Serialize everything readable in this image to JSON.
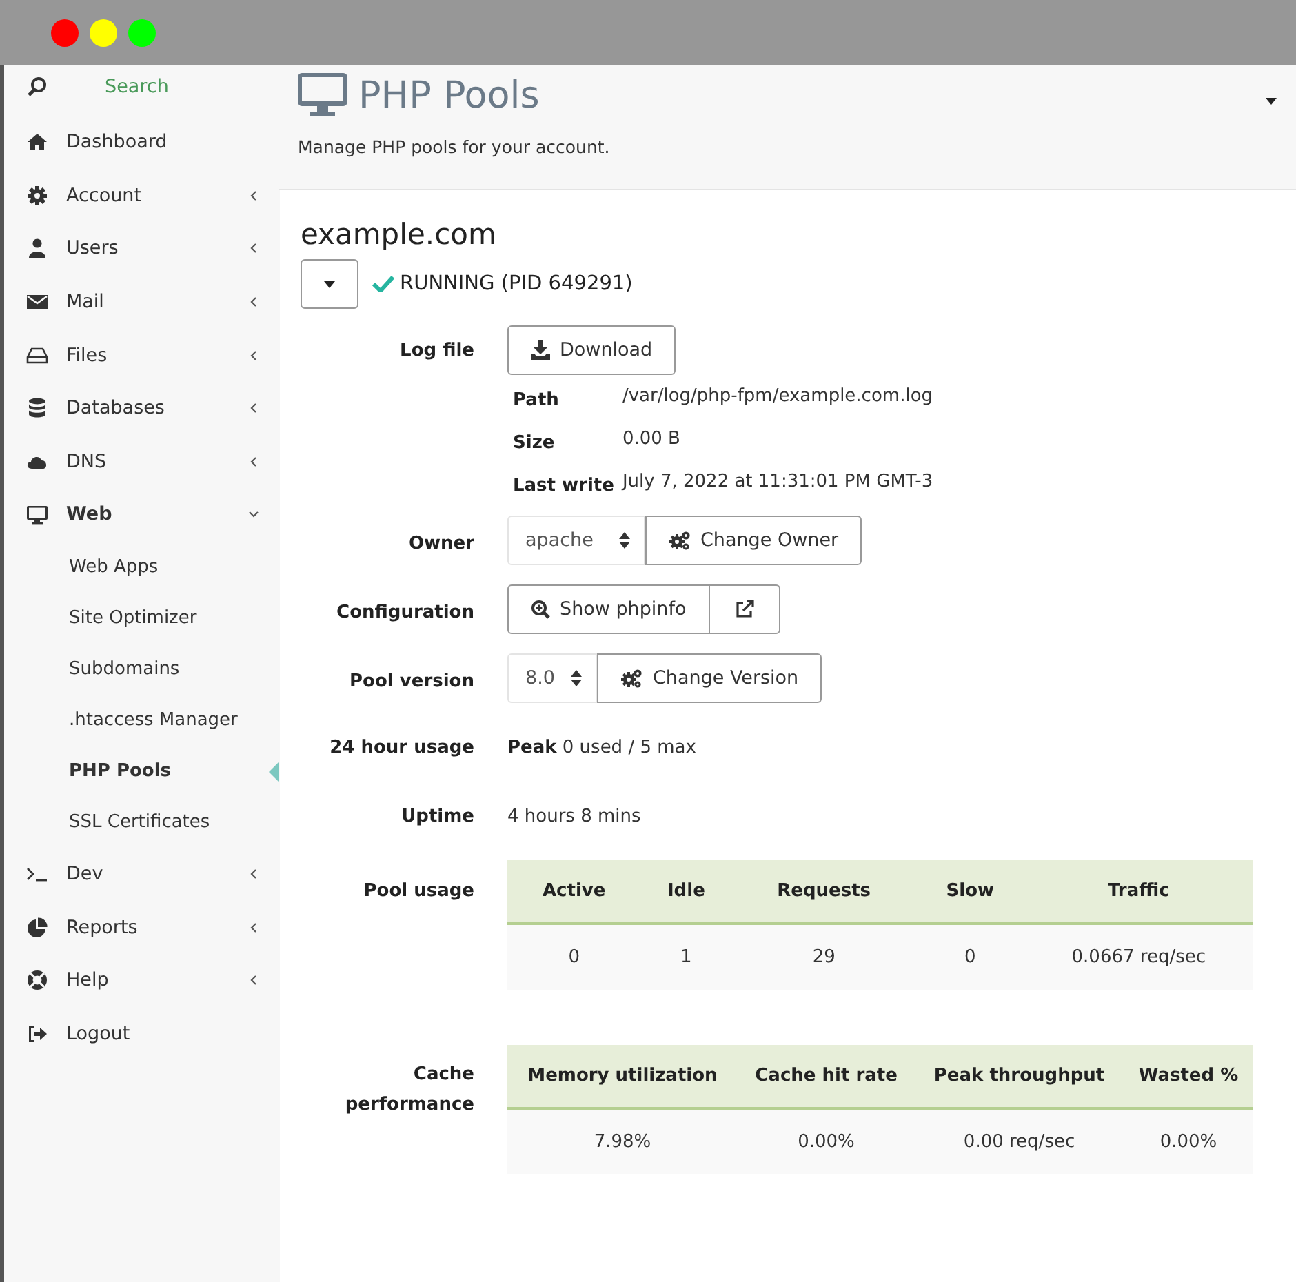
{
  "sidebar": {
    "search": {
      "placeholder": "Search"
    },
    "items": [
      {
        "label": "Dashboard",
        "expandable": false,
        "expanded": false
      },
      {
        "label": "Account",
        "expandable": true,
        "expanded": false
      },
      {
        "label": "Users",
        "expandable": true,
        "expanded": false
      },
      {
        "label": "Mail",
        "expandable": true,
        "expanded": false
      },
      {
        "label": "Files",
        "expandable": true,
        "expanded": false
      },
      {
        "label": "Databases",
        "expandable": true,
        "expanded": false
      },
      {
        "label": "DNS",
        "expandable": true,
        "expanded": false
      },
      {
        "label": "Web",
        "expandable": true,
        "expanded": true,
        "children": [
          {
            "label": "Web Apps",
            "selected": false
          },
          {
            "label": "Site Optimizer",
            "selected": false
          },
          {
            "label": "Subdomains",
            "selected": false
          },
          {
            "label": ".htaccess Manager",
            "selected": false
          },
          {
            "label": "PHP Pools",
            "selected": true
          },
          {
            "label": "SSL Certificates",
            "selected": false
          }
        ]
      },
      {
        "label": "Dev",
        "expandable": true,
        "expanded": false
      },
      {
        "label": "Reports",
        "expandable": true,
        "expanded": false
      },
      {
        "label": "Help",
        "expandable": true,
        "expanded": false
      },
      {
        "label": "Logout",
        "expandable": false,
        "expanded": false
      }
    ]
  },
  "header": {
    "title": "PHP Pools",
    "subtitle": "Manage PHP pools for your account."
  },
  "pool": {
    "name": "example.com",
    "status": "RUNNING (PID 649291)",
    "running": true,
    "log_file": {
      "label": "Log file",
      "button": "Download",
      "details": [
        {
          "label": "Path",
          "value": "/var/log/php-fpm/example.com.log"
        },
        {
          "label": "Size",
          "value": "0.00 B"
        },
        {
          "label": "Last write",
          "value": "July 7, 2022 at 11:31:01 PM GMT-3"
        }
      ]
    },
    "owner": {
      "label": "Owner",
      "value": "apache",
      "button": "Change Owner"
    },
    "configuration": {
      "label": "Configuration",
      "button": "Show phpinfo"
    },
    "pool_version": {
      "label": "Pool version",
      "value": "8.0",
      "button": "Change Version"
    },
    "usage_24h": {
      "label": "24 hour usage",
      "text": "**Peak** 0 used / 5 max"
    },
    "uptime": {
      "label": "Uptime",
      "value": "4 hours 8 mins"
    },
    "pool_usage": {
      "label": "Pool usage",
      "columns": [
        "Active",
        "Idle",
        "Requests",
        "Slow",
        "Traffic"
      ],
      "rows": [
        [
          "0",
          "1",
          "29",
          "0",
          "0.0667 req/sec"
        ]
      ]
    },
    "cache_performance": {
      "label": "Cache performance",
      "columns": [
        "Memory utilization",
        "Cache hit rate",
        "Peak throughput",
        "Wasted %"
      ],
      "rows": [
        [
          "7.98%",
          "0.00%",
          "0.00 req/sec",
          "0.00%"
        ]
      ]
    }
  }
}
